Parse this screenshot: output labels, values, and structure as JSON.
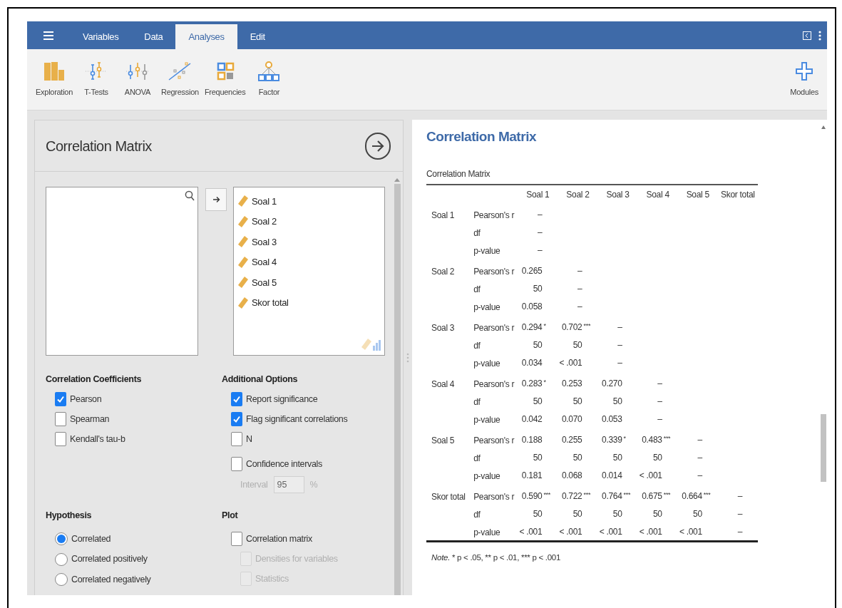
{
  "menu_tabs": [
    {
      "label": "Variables",
      "selected": false
    },
    {
      "label": "Data",
      "selected": false
    },
    {
      "label": "Analyses",
      "selected": true
    },
    {
      "label": "Edit",
      "selected": false
    }
  ],
  "toolbar": [
    {
      "label": "Exploration",
      "kind": "bars"
    },
    {
      "label": "T-Tests",
      "kind": "ttest"
    },
    {
      "label": "ANOVA",
      "kind": "anova"
    },
    {
      "label": "Regression",
      "kind": "regression"
    },
    {
      "label": "Frequencies",
      "kind": "frequencies"
    },
    {
      "label": "Factor",
      "kind": "factor"
    }
  ],
  "modules": {
    "label": "Modules"
  },
  "options_panel": {
    "title": "Correlation Matrix",
    "variables": [
      "Soal 1",
      "Soal 2",
      "Soal 3",
      "Soal 4",
      "Soal 5",
      "Skor total"
    ],
    "correlation_coefficients": {
      "heading": "Correlation Coefficients",
      "options": [
        {
          "label": "Pearson",
          "checked": true
        },
        {
          "label": "Spearman",
          "checked": false
        },
        {
          "label": "Kendall's tau-b",
          "checked": false
        }
      ]
    },
    "additional_options": {
      "heading": "Additional Options",
      "options": [
        {
          "label": "Report significance",
          "checked": true
        },
        {
          "label": "Flag significant correlations",
          "checked": true
        },
        {
          "label": "N",
          "checked": false
        },
        {
          "label": "Confidence intervals",
          "checked": false
        }
      ],
      "interval": {
        "label": "Interval",
        "value": "95",
        "unit": "%",
        "disabled": true
      }
    },
    "hypothesis": {
      "heading": "Hypothesis",
      "options": [
        {
          "label": "Correlated",
          "selected": true
        },
        {
          "label": "Correlated positively",
          "selected": false
        },
        {
          "label": "Correlated negatively",
          "selected": false
        }
      ]
    },
    "plot": {
      "heading": "Plot",
      "options": [
        {
          "label": "Correlation matrix",
          "checked": false,
          "disabled": false,
          "children": [
            {
              "label": "Densities for variables",
              "checked": false,
              "disabled": true
            },
            {
              "label": "Statistics",
              "checked": false,
              "disabled": true
            }
          ]
        }
      ]
    }
  },
  "results": {
    "heading": "Correlation Matrix",
    "table": {
      "caption": "Correlation Matrix",
      "columns": [
        "Soal 1",
        "Soal 2",
        "Soal 3",
        "Soal 4",
        "Soal 5",
        "Skor total"
      ],
      "rows": [
        {
          "variable": "Soal 1",
          "stats": [
            {
              "label": "Pearson's r",
              "cells": [
                {
                  "value": "–"
                }
              ]
            },
            {
              "label": "df",
              "cells": [
                {
                  "value": "–"
                }
              ]
            },
            {
              "label": "p-value",
              "cells": [
                {
                  "value": "–"
                }
              ]
            }
          ]
        },
        {
          "variable": "Soal 2",
          "stats": [
            {
              "label": "Pearson's r",
              "cells": [
                {
                  "value": "0.265"
                },
                {
                  "value": "–"
                }
              ]
            },
            {
              "label": "df",
              "cells": [
                {
                  "value": "50"
                },
                {
                  "value": "–"
                }
              ]
            },
            {
              "label": "p-value",
              "cells": [
                {
                  "value": "0.058"
                },
                {
                  "value": "–"
                }
              ]
            }
          ]
        },
        {
          "variable": "Soal 3",
          "stats": [
            {
              "label": "Pearson's r",
              "cells": [
                {
                  "value": "0.294",
                  "flag": "*"
                },
                {
                  "value": "0.702",
                  "flag": "***"
                },
                {
                  "value": "–"
                }
              ]
            },
            {
              "label": "df",
              "cells": [
                {
                  "value": "50"
                },
                {
                  "value": "50"
                },
                {
                  "value": "–"
                }
              ]
            },
            {
              "label": "p-value",
              "cells": [
                {
                  "value": "0.034"
                },
                {
                  "value": "< .001"
                },
                {
                  "value": "–"
                }
              ]
            }
          ]
        },
        {
          "variable": "Soal 4",
          "stats": [
            {
              "label": "Pearson's r",
              "cells": [
                {
                  "value": "0.283",
                  "flag": "*"
                },
                {
                  "value": "0.253"
                },
                {
                  "value": "0.270"
                },
                {
                  "value": "–"
                }
              ]
            },
            {
              "label": "df",
              "cells": [
                {
                  "value": "50"
                },
                {
                  "value": "50"
                },
                {
                  "value": "50"
                },
                {
                  "value": "–"
                }
              ]
            },
            {
              "label": "p-value",
              "cells": [
                {
                  "value": "0.042"
                },
                {
                  "value": "0.070"
                },
                {
                  "value": "0.053"
                },
                {
                  "value": "–"
                }
              ]
            }
          ]
        },
        {
          "variable": "Soal 5",
          "stats": [
            {
              "label": "Pearson's r",
              "cells": [
                {
                  "value": "0.188"
                },
                {
                  "value": "0.255"
                },
                {
                  "value": "0.339",
                  "flag": "*"
                },
                {
                  "value": "0.483",
                  "flag": "***"
                },
                {
                  "value": "–"
                }
              ]
            },
            {
              "label": "df",
              "cells": [
                {
                  "value": "50"
                },
                {
                  "value": "50"
                },
                {
                  "value": "50"
                },
                {
                  "value": "50"
                },
                {
                  "value": "–"
                }
              ]
            },
            {
              "label": "p-value",
              "cells": [
                {
                  "value": "0.181"
                },
                {
                  "value": "0.068"
                },
                {
                  "value": "0.014"
                },
                {
                  "value": "< .001"
                },
                {
                  "value": "–"
                }
              ]
            }
          ]
        },
        {
          "variable": "Skor total",
          "stats": [
            {
              "label": "Pearson's r",
              "cells": [
                {
                  "value": "0.590",
                  "flag": "***"
                },
                {
                  "value": "0.722",
                  "flag": "***"
                },
                {
                  "value": "0.764",
                  "flag": "***"
                },
                {
                  "value": "0.675",
                  "flag": "***"
                },
                {
                  "value": "0.664",
                  "flag": "***"
                },
                {
                  "value": "–"
                }
              ]
            },
            {
              "label": "df",
              "cells": [
                {
                  "value": "50"
                },
                {
                  "value": "50"
                },
                {
                  "value": "50"
                },
                {
                  "value": "50"
                },
                {
                  "value": "50"
                },
                {
                  "value": "–"
                }
              ]
            },
            {
              "label": "p-value",
              "cells": [
                {
                  "value": "< .001"
                },
                {
                  "value": "< .001"
                },
                {
                  "value": "< .001"
                },
                {
                  "value": "< .001"
                },
                {
                  "value": "< .001"
                },
                {
                  "value": "–"
                }
              ]
            }
          ]
        }
      ],
      "note_label": "Note.",
      "note": "* p < .05, ** p < .01, *** p < .001"
    }
  }
}
